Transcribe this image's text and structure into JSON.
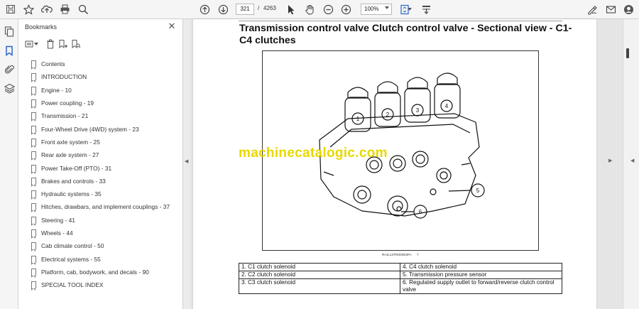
{
  "toolbar": {
    "icons": [
      "save-icon",
      "bookmark-star-icon",
      "cloud-upload-icon",
      "print-icon",
      "zoom-search-icon",
      "page-up-icon",
      "page-down-icon",
      "cursor-icon",
      "hand-icon",
      "zoom-out-icon",
      "zoom-in-icon",
      "fit-page-icon",
      "scroll-mode-icon",
      "sign-icon",
      "email-icon",
      "account-icon"
    ],
    "page_current": "321",
    "page_sep": "/",
    "page_total": "4263",
    "zoom": "100%"
  },
  "bookmarks_panel": {
    "title": "Bookmarks",
    "items": [
      {
        "label": "Contents"
      },
      {
        "label": "INTRODUCTION"
      },
      {
        "label": "Engine - 10"
      },
      {
        "label": "Power coupling - 19"
      },
      {
        "label": "Transmission - 21"
      },
      {
        "label": "Four-Wheel Drive (4WD) system - 23"
      },
      {
        "label": "Front axle system - 25"
      },
      {
        "label": "Rear axle system - 27"
      },
      {
        "label": "Power Take-Off (PTO) - 31"
      },
      {
        "label": "Brakes and controls - 33"
      },
      {
        "label": "Hydraulic systems - 35"
      },
      {
        "label": "Hitches, drawbars, and implement couplings - 37"
      },
      {
        "label": "Steering - 41"
      },
      {
        "label": "Wheels - 44"
      },
      {
        "label": "Cab climate control - 50"
      },
      {
        "label": "Electrical systems - 55"
      },
      {
        "label": "Platform, cab, bodywork, and decals - 90"
      },
      {
        "label": "SPECIAL TOOL INDEX"
      }
    ]
  },
  "document": {
    "heading": "Transmission control valve Clutch control valve - Sectional view - C1-C4 clutches",
    "watermark": "machinecatalogic.com",
    "figure_code": "RAIL13TR00063FA",
    "figure_number": "7",
    "callouts": [
      "1",
      "2",
      "3",
      "4",
      "5",
      "6"
    ],
    "legend": [
      [
        "1.  C1 clutch solenoid",
        "4.  C4 clutch solenoid"
      ],
      [
        "2.  C2 clutch solenoid",
        "5.  Transmission pressure sensor"
      ],
      [
        "3.  C3 clutch solenoid",
        "6.  Regulated supply outlet to forward/reverse clutch control valve"
      ]
    ]
  },
  "colors": {
    "watermark": "#e8d800",
    "toolbar_bg": "#f5f5f5",
    "panel_bg": "#ffffff"
  }
}
